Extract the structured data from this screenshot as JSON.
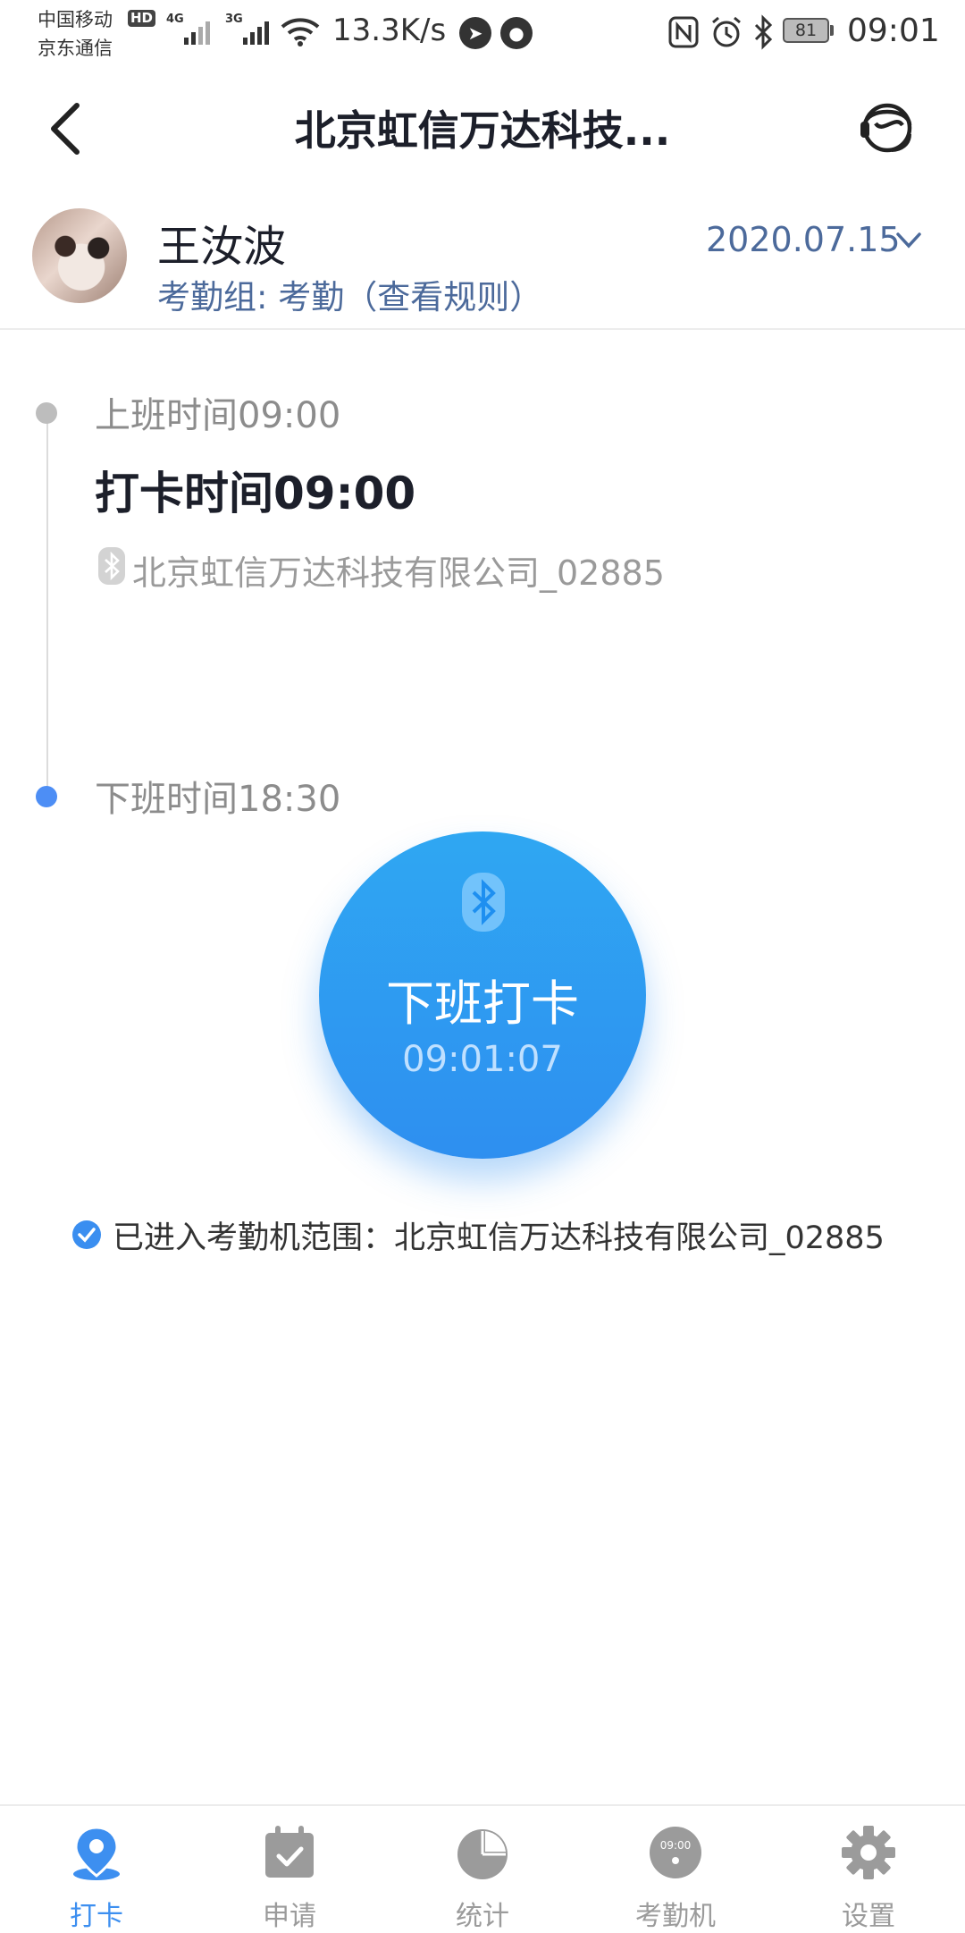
{
  "status_bar": {
    "carrier_1": "中国移动",
    "carrier_2": "京东通信",
    "hd_badge": "HD",
    "network_1": "4G",
    "network_2": "3G",
    "speed": "13.3K/s",
    "battery": "81",
    "time": "09:01"
  },
  "header": {
    "title": "北京虹信万达科技...",
    "back_icon": "chevron-left-icon",
    "service_icon": "customer-service-icon"
  },
  "user": {
    "name": "王汝波",
    "group": "考勤组: 考勤（查看规则）",
    "date": "2020.07.15"
  },
  "timeline": {
    "on_duty_label": "上班时间09:00",
    "punch_time": "打卡时间09:00",
    "device_name": "北京虹信万达科技有限公司_02885",
    "off_duty_label": "下班时间18:30"
  },
  "punch_button": {
    "label": "下班打卡",
    "clock": "09:01:07",
    "icon": "bluetooth-icon"
  },
  "range_notice": {
    "text": "已进入考勤机范围：北京虹信万达科技有限公司_02885"
  },
  "colors": {
    "accent": "#2e8ff0",
    "secondary_text": "#4c6a9b",
    "muted_text": "#8c8c8c"
  },
  "bottom_nav": {
    "items": [
      {
        "label": "打卡",
        "icon": "location-pin-icon",
        "active": true
      },
      {
        "label": "申请",
        "icon": "calendar-check-icon",
        "active": false
      },
      {
        "label": "统计",
        "icon": "pie-chart-icon",
        "active": false
      },
      {
        "label": "考勤机",
        "icon": "clock-device-icon",
        "active": false,
        "icon_text": "09:00"
      },
      {
        "label": "设置",
        "icon": "gear-icon",
        "active": false
      }
    ]
  }
}
